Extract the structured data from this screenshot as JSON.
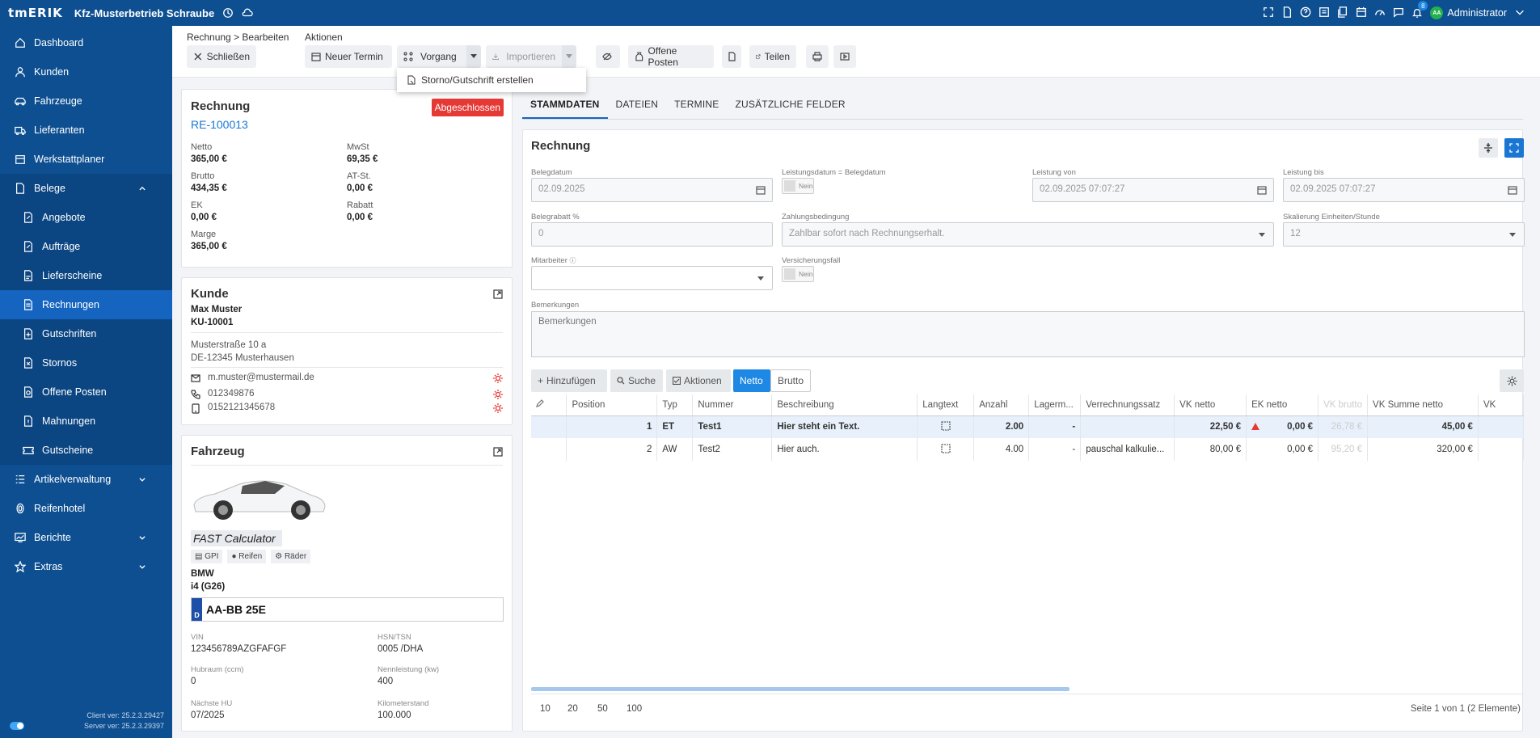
{
  "app": {
    "logo": "tmERIK",
    "company": "Kfz-Musterbetrieb Schraube",
    "user": "Administrator",
    "user_initials": "AA",
    "notification_count": "8"
  },
  "colors": {
    "nav_bg": "#0d4f91",
    "nav_active": "#1565c0",
    "accent": "#1976d2",
    "status_closed": "#e53935"
  },
  "sidebar": {
    "items": [
      {
        "label": "Dashboard",
        "icon": "dashboard-icon"
      },
      {
        "label": "Kunden",
        "icon": "user-icon"
      },
      {
        "label": "Fahrzeuge",
        "icon": "car-icon"
      },
      {
        "label": "Lieferanten",
        "icon": "truck-icon"
      },
      {
        "label": "Werkstattplaner",
        "icon": "calendar-icon"
      },
      {
        "label": "Belege",
        "icon": "document-icon"
      },
      {
        "label": "Angebote",
        "icon": "document-edit-icon"
      },
      {
        "label": "Aufträge",
        "icon": "document-edit-icon"
      },
      {
        "label": "Lieferscheine",
        "icon": "delivery-note-icon"
      },
      {
        "label": "Rechnungen",
        "icon": "invoice-icon"
      },
      {
        "label": "Gutschriften",
        "icon": "credit-icon"
      },
      {
        "label": "Stornos",
        "icon": "cancel-doc-icon"
      },
      {
        "label": "Offene Posten",
        "icon": "open-items-icon"
      },
      {
        "label": "Mahnungen",
        "icon": "reminder-icon"
      },
      {
        "label": "Gutscheine",
        "icon": "voucher-icon"
      },
      {
        "label": "Artikelverwaltung",
        "icon": "list-icon"
      },
      {
        "label": "Reifenhotel",
        "icon": "tire-icon"
      },
      {
        "label": "Berichte",
        "icon": "chart-icon"
      },
      {
        "label": "Extras",
        "icon": "star-icon"
      }
    ],
    "client_version": "Client ver: 25.2.3.29427",
    "server_version": "Server ver: 25.2.3.29397"
  },
  "toolbar": {
    "breadcrumb": "Rechnung > Bearbeiten",
    "actions_label": "Aktionen",
    "close": "Schließen",
    "new_appointment": "Neuer Termin",
    "process": "Vorgang",
    "import": "Importieren",
    "open_items": "Offene Posten",
    "share": "Teilen",
    "dropdown_item": "Storno/Gutschrift erstellen"
  },
  "summary": {
    "title": "Rechnung",
    "number": "RE-100013",
    "status": "Abgeschlossen",
    "fields": [
      {
        "label": "Netto",
        "value": "365,00 €"
      },
      {
        "label": "MwSt",
        "value": "69,35 €"
      },
      {
        "label": "Brutto",
        "value": "434,35 €"
      },
      {
        "label": "AT-St.",
        "value": "0,00 €"
      },
      {
        "label": "EK",
        "value": "0,00 €"
      },
      {
        "label": "Rabatt",
        "value": "0,00 €"
      },
      {
        "label": "Marge",
        "value": "365,00 €"
      }
    ]
  },
  "customer": {
    "title": "Kunde",
    "name": "Max Muster",
    "number": "KU-10001",
    "street": "Musterstraße 10 a",
    "city": "DE-12345 Musterhausen",
    "email": "m.muster@mustermail.de",
    "phone": "012349876",
    "mobile": "0152121345678"
  },
  "vehicle": {
    "title": "Fahrzeug",
    "calculator": "FAST Calculator",
    "chips": [
      "GPI",
      "Reifen",
      "Räder"
    ],
    "make": "BMW",
    "model": "i4 (G26)",
    "plate_country": "D",
    "plate": "AA-BB 25E",
    "fields": [
      {
        "label": "VIN",
        "value": "123456789AZGFAFGF"
      },
      {
        "label": "HSN/TSN",
        "value": "0005 /DHA"
      },
      {
        "label": "Hubraum (ccm)",
        "value": "0"
      },
      {
        "label": "Nennleistung (kw)",
        "value": "400"
      },
      {
        "label": "Nächste HU",
        "value": "07/2025"
      },
      {
        "label": "Kilometerstand",
        "value": "100.000"
      }
    ]
  },
  "tabs": [
    "STAMMDATEN",
    "DATEIEN",
    "TERMINE",
    "ZUSÄTZLICHE FELDER"
  ],
  "form": {
    "title": "Rechnung",
    "belegdatum_label": "Belegdatum",
    "belegdatum": "02.09.2025",
    "leistungsdatum_label": "Leistungsdatum = Belegdatum",
    "leistungsdatum_toggle": "Nein",
    "leistung_von_label": "Leistung von",
    "leistung_von": "02.09.2025 07:07:27",
    "leistung_bis_label": "Leistung bis",
    "leistung_bis": "02.09.2025 07:07:27",
    "belegrabatt_label": "Belegrabatt %",
    "belegrabatt": "0",
    "zahlung_label": "Zahlungsbedingung",
    "zahlung": "Zahlbar sofort nach Rechnungserhalt.",
    "skalierung_label": "Skalierung Einheiten/Stunde",
    "skalierung": "12",
    "mitarbeiter_label": "Mitarbeiter",
    "versicherung_label": "Versicherungsfall",
    "versicherung_toggle": "Nein",
    "bemerkungen_label": "Bemerkungen",
    "bemerkungen_placeholder": "Bemerkungen"
  },
  "grid": {
    "add": "Hinzufügen",
    "search": "Suche",
    "actions": "Aktionen",
    "netto": "Netto",
    "brutto": "Brutto",
    "columns": [
      "Position",
      "Typ",
      "Nummer",
      "Beschreibung",
      "Langtext",
      "Anzahl",
      "Lagerm...",
      "Verrechnungssatz",
      "VK netto",
      "EK netto",
      "VK brutto",
      "VK Summe netto",
      "VK"
    ],
    "rows": [
      {
        "pos": "1",
        "typ": "ET",
        "nummer": "Test1",
        "beschreibung": "Hier steht ein Text.",
        "anzahl": "2.00",
        "lager": "-",
        "satz": "",
        "vk_netto": "22,50 €",
        "ek_netto": "0,00 €",
        "vk_brutto": "26,78 €",
        "vk_summe": "45,00 €"
      },
      {
        "pos": "2",
        "typ": "AW",
        "nummer": "Test2",
        "beschreibung": "Hier auch.",
        "anzahl": "4.00",
        "lager": "-",
        "satz": "pauschal kalkulie...",
        "vk_netto": "80,00 €",
        "ek_netto": "0,00 €",
        "vk_brutto": "95,20 €",
        "vk_summe": "320,00 €"
      }
    ],
    "page_sizes": [
      "10",
      "20",
      "50",
      "100"
    ],
    "page_info": "Seite 1 von 1 (2 Elemente)"
  }
}
